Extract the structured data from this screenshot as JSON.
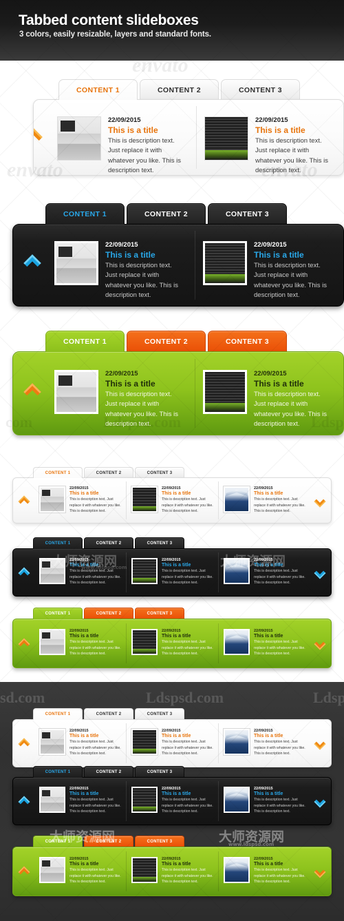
{
  "header": {
    "title": "Tabbed content slideboxes",
    "subtitle": "3 colors, easily resizable, layers and standard fonts."
  },
  "tabs": {
    "tab1": "CONTENT 1",
    "tab2": "CONTENT 2",
    "tab3": "CONTENT 3"
  },
  "item": {
    "date": "22/09/2015",
    "title": "This is a title",
    "desc": "This is description text. Just replace it with whatever you like. This is description text."
  },
  "icons": {
    "prev": "chevron-left-icon",
    "next": "chevron-right-icon"
  },
  "colors": {
    "orange": "#e8740c",
    "orange_tab": "#ea4f06",
    "blue": "#29a7e8",
    "green": "#8ec31d",
    "dark_panel": "#1c1c1c",
    "light_panel": "#fafafa"
  },
  "watermarks": {
    "envato": "envato",
    "ldspsd": "Ldspsd.com",
    "ldsp": "Ldsp",
    "sd": "sd.com",
    "com": "com",
    "cn": "大师资源网",
    "cn_url": "www.ldspsd.com"
  },
  "variants": [
    {
      "name": "large-light",
      "theme": "light",
      "active_tab": 1
    },
    {
      "name": "large-dark",
      "theme": "dark",
      "active_tab": 1
    },
    {
      "name": "large-green",
      "theme": "green",
      "active_tab": 1
    },
    {
      "name": "small-light",
      "theme": "light",
      "active_tab": 1
    },
    {
      "name": "small-dark",
      "theme": "dark",
      "active_tab": 1
    },
    {
      "name": "small-green",
      "theme": "green",
      "active_tab": 1
    },
    {
      "name": "dark-bg-light",
      "theme": "light",
      "active_tab": 1
    },
    {
      "name": "dark-bg-dark",
      "theme": "dark",
      "active_tab": 1
    },
    {
      "name": "dark-bg-green",
      "theme": "green",
      "active_tab": 1
    }
  ]
}
